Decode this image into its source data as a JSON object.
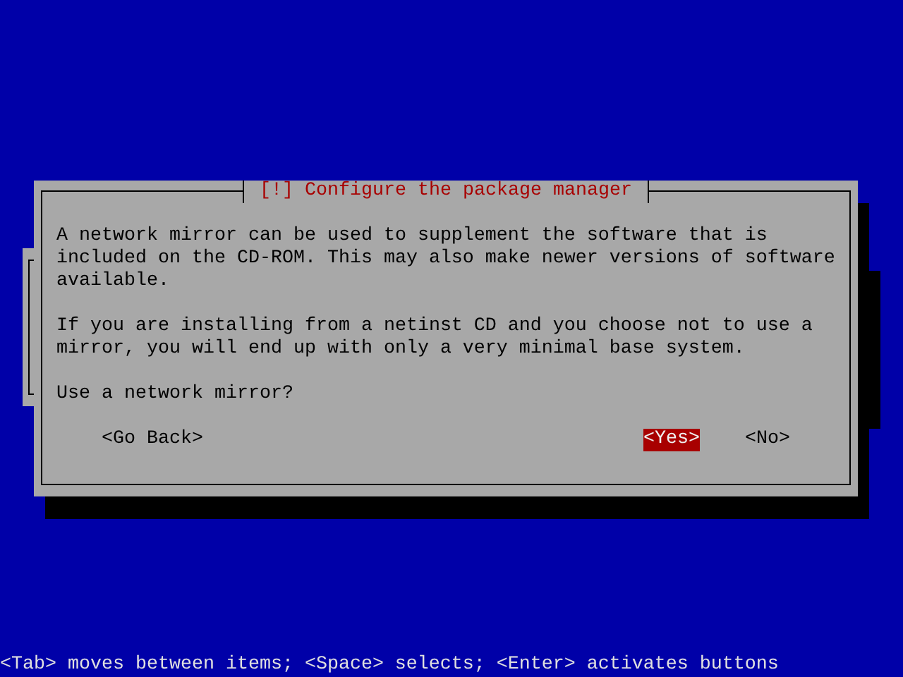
{
  "dialog": {
    "title": "[!] Configure the package manager",
    "paragraphs": [
      [
        "A network mirror can be used to supplement the software that is",
        "included on the CD-ROM. This may also make newer versions of software",
        "available."
      ],
      [
        "If you are installing from a netinst CD and you choose not to use a",
        "mirror, you will end up with only a very minimal base system."
      ],
      [
        "Use a network mirror?"
      ]
    ],
    "buttons": [
      {
        "label": "<Go Back>",
        "selected": false
      },
      {
        "label": "<Yes>",
        "selected": true
      },
      {
        "label": "<No>",
        "selected": false
      }
    ]
  },
  "status_bar": "<Tab> moves between items; <Space> selects; <Enter> activates buttons"
}
